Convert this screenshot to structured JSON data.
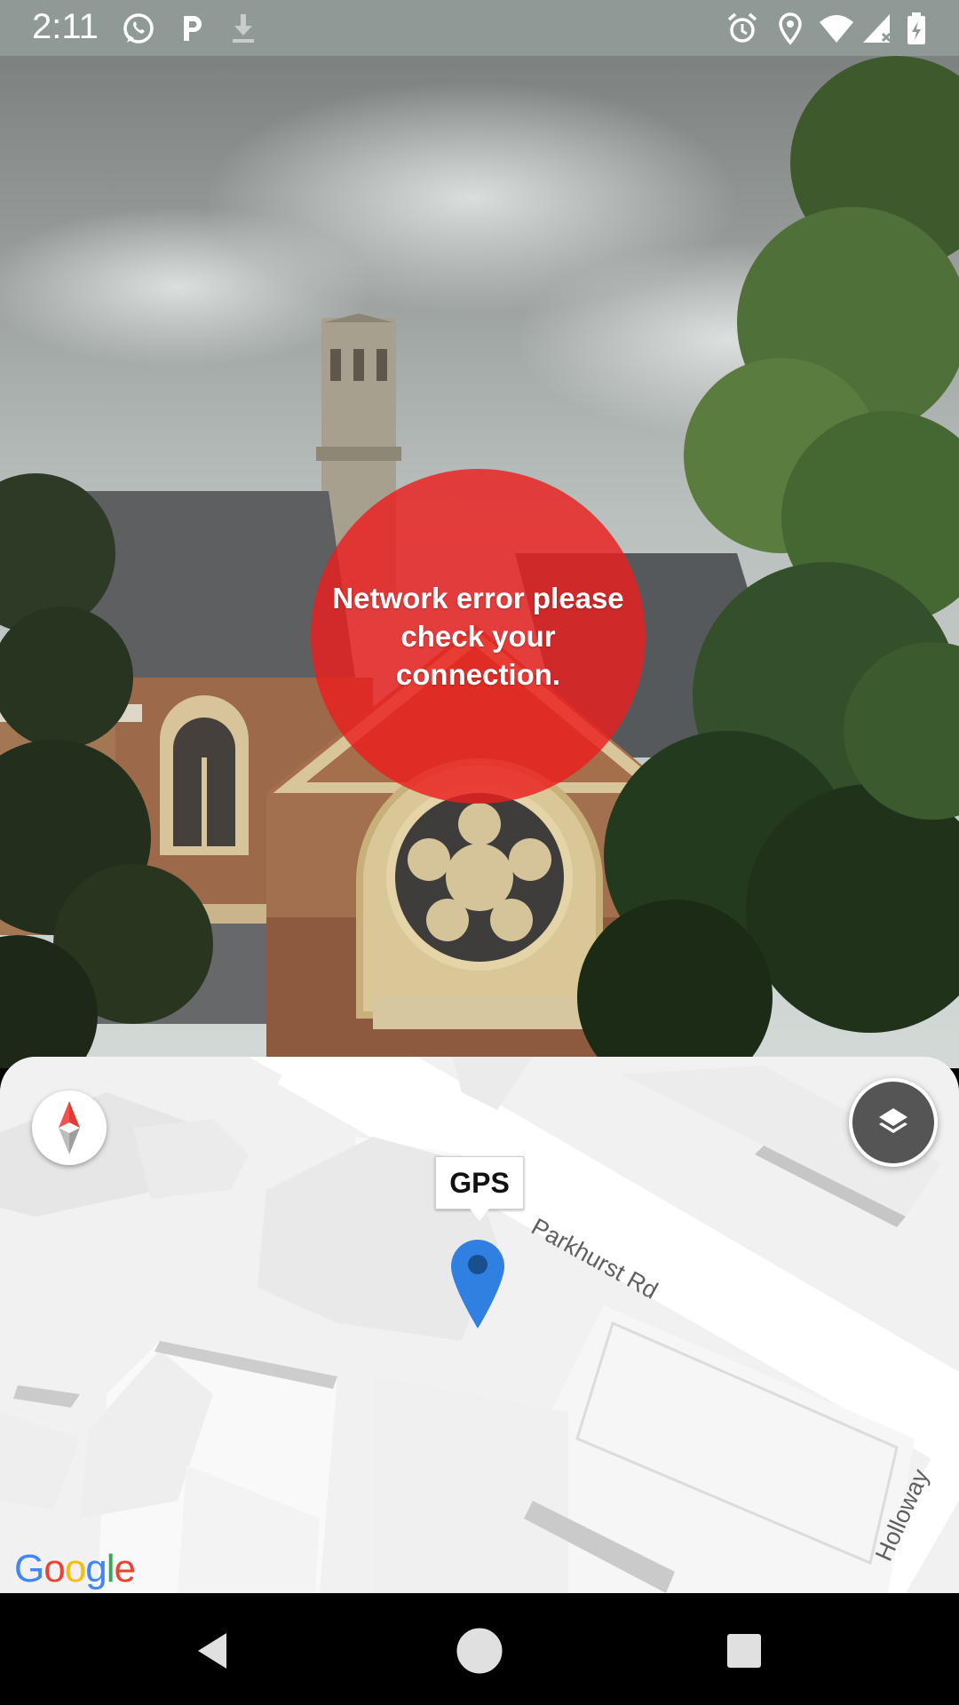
{
  "status_bar": {
    "time": "2:11",
    "left_icons": [
      "whatsapp-icon",
      "parking-icon",
      "download-icon"
    ],
    "right_icons": [
      "alarm-icon",
      "location-icon",
      "wifi-icon",
      "signal-icon",
      "battery-icon"
    ],
    "background": "#8f9a97"
  },
  "camera_view": {
    "error_message": "Network error please check your connection.",
    "error_color": "#eb1e1e"
  },
  "map": {
    "gps_label": "GPS",
    "street_name": "Parkhurst Rd",
    "street_name_2": "Holloway",
    "google_logo": [
      "G",
      "o",
      "o",
      "g",
      "l",
      "e"
    ],
    "pin_color": "#2f80e0",
    "compass_icon": "compass-icon",
    "layers_icon": "layers-icon"
  },
  "nav_bar": {
    "icons": [
      "back-icon",
      "home-icon",
      "recents-icon"
    ]
  }
}
